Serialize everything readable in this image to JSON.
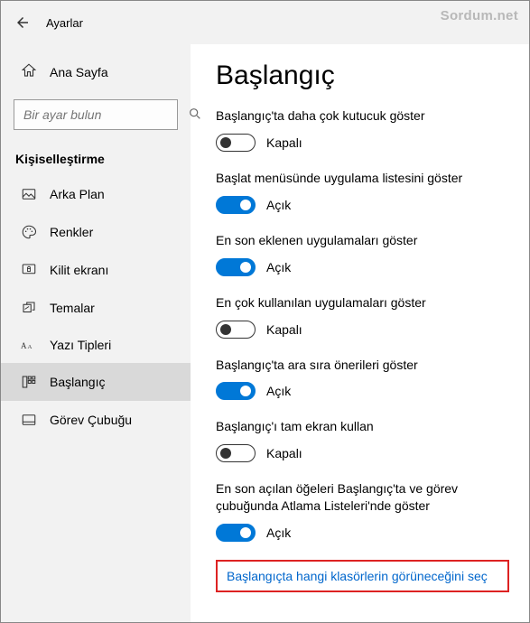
{
  "watermark": "Sordum.net",
  "header": {
    "title": "Ayarlar"
  },
  "sidebar": {
    "home": "Ana Sayfa",
    "search_placeholder": "Bir ayar bulun",
    "section": "Kişiselleştirme",
    "items": [
      {
        "label": "Arka Plan"
      },
      {
        "label": "Renkler"
      },
      {
        "label": "Kilit ekranı"
      },
      {
        "label": "Temalar"
      },
      {
        "label": "Yazı Tipleri"
      },
      {
        "label": "Başlangıç"
      },
      {
        "label": "Görev Çubuğu"
      }
    ]
  },
  "page": {
    "title": "Başlangıç",
    "state_on": "Açık",
    "state_off": "Kapalı",
    "settings": [
      {
        "label": "Başlangıç'ta daha çok kutucuk göster",
        "on": false
      },
      {
        "label": "Başlat menüsünde uygulama listesini göster",
        "on": true
      },
      {
        "label": "En son eklenen uygulamaları göster",
        "on": true
      },
      {
        "label": "En çok kullanılan uygulamaları göster",
        "on": false
      },
      {
        "label": "Başlangıç'ta ara sıra önerileri göster",
        "on": true
      },
      {
        "label": "Başlangıç'ı tam ekran kullan",
        "on": false
      },
      {
        "label": "En son açılan öğeleri Başlangıç'ta ve görev çubuğunda Atlama  Listeleri'nde göster",
        "on": true
      }
    ],
    "link": "Başlangıçta hangi klasörlerin görüneceğini seç"
  }
}
